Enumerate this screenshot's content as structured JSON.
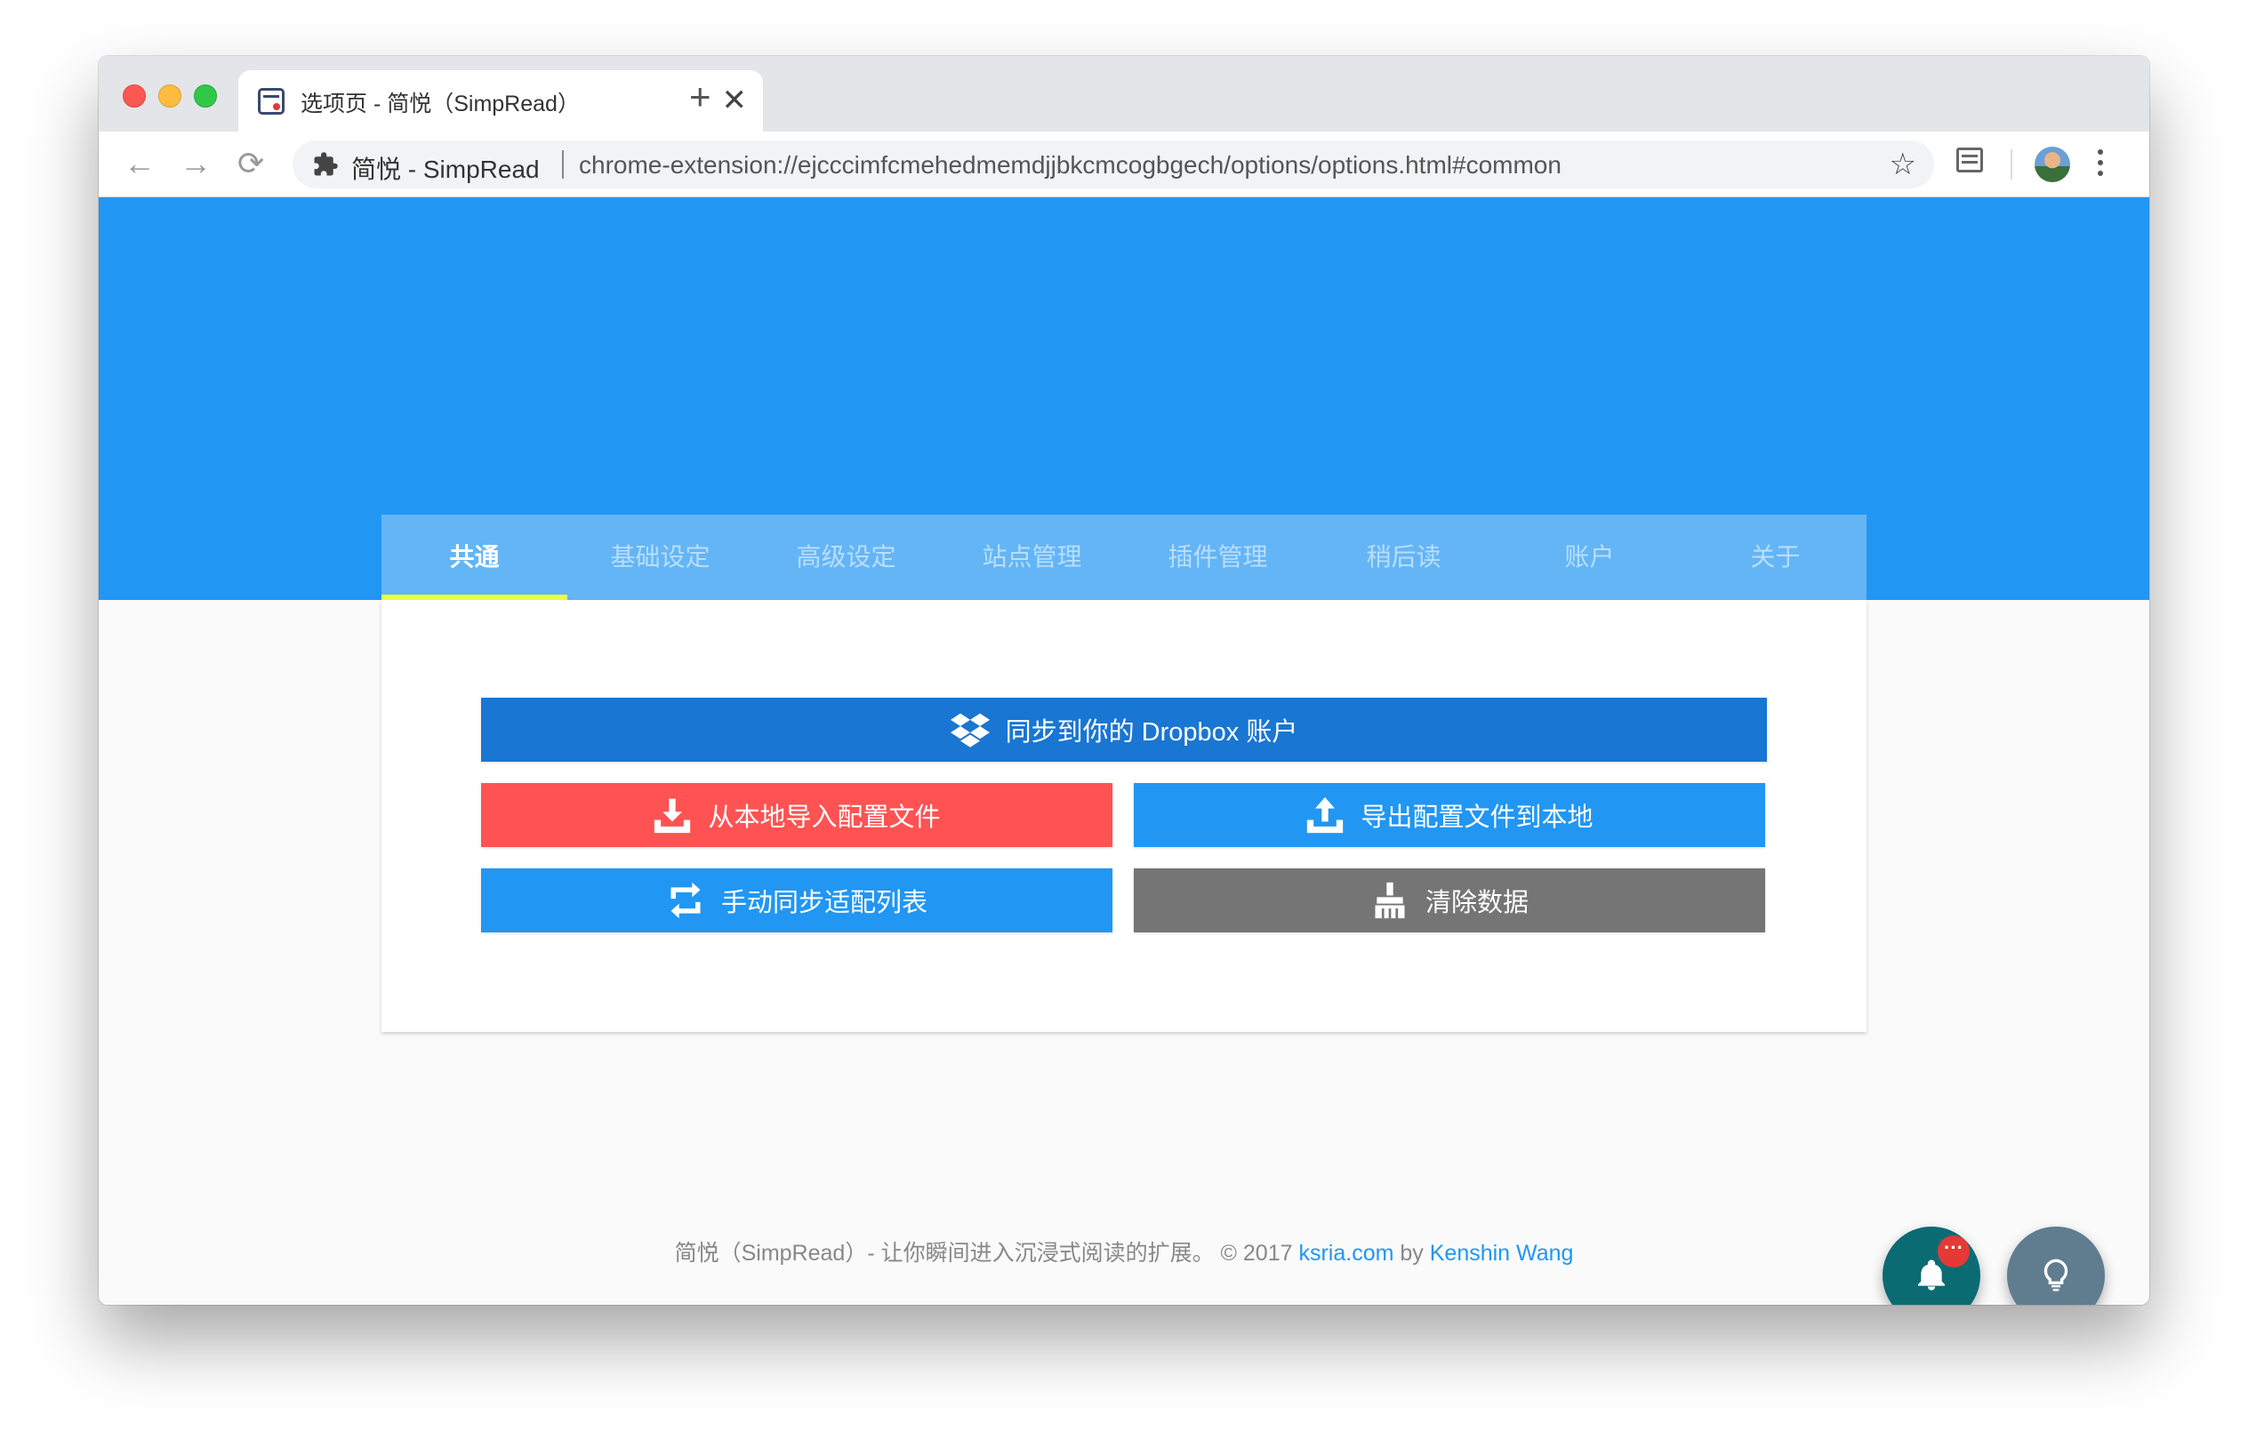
{
  "browser": {
    "tab": {
      "title": "选项页 - 简悦（SimpRead）",
      "close_glyph": "✕"
    },
    "new_tab_glyph": "+",
    "nav": {
      "back_glyph": "←",
      "forward_glyph": "→",
      "reload_glyph": "⟳"
    },
    "omnibox": {
      "extension_name": "简悦 - SimpRead",
      "url": "chrome-extension://ejcccimfcmehedmemdjjbkcmcogbgech/options/options.html#common",
      "star_glyph": "☆"
    }
  },
  "options": {
    "tabs": [
      {
        "label": "共通",
        "active": true
      },
      {
        "label": "基础设定",
        "active": false
      },
      {
        "label": "高级设定",
        "active": false
      },
      {
        "label": "站点管理",
        "active": false
      },
      {
        "label": "插件管理",
        "active": false
      },
      {
        "label": "稍后读",
        "active": false
      },
      {
        "label": "账户",
        "active": false
      },
      {
        "label": "关于",
        "active": false
      }
    ],
    "buttons": {
      "dropbox": {
        "label": "同步到你的 Dropbox 账户",
        "icon": "dropbox-icon",
        "color": "#1976d2"
      },
      "import": {
        "label": "从本地导入配置文件",
        "icon": "download-icon",
        "color": "#ff5252"
      },
      "export": {
        "label": "导出配置文件到本地",
        "icon": "upload-icon",
        "color": "#2196f3"
      },
      "sync_list": {
        "label": "手动同步适配列表",
        "icon": "sync-icon",
        "color": "#2196f3"
      },
      "clear": {
        "label": "清除数据",
        "icon": "broom-icon",
        "color": "#757575"
      }
    }
  },
  "footer": {
    "text": "简悦（SimpRead）- 让你瞬间进入沉浸式阅读的扩展。 © 2017 ",
    "site_link": "ksria.com",
    "by": " by ",
    "author_link": "Kenshin Wang"
  },
  "fabs": {
    "notification_badge": "···"
  },
  "colors": {
    "hero": "#2196f3",
    "tabs_bar": "#64b5f6",
    "active_indicator": "#eeff41"
  }
}
